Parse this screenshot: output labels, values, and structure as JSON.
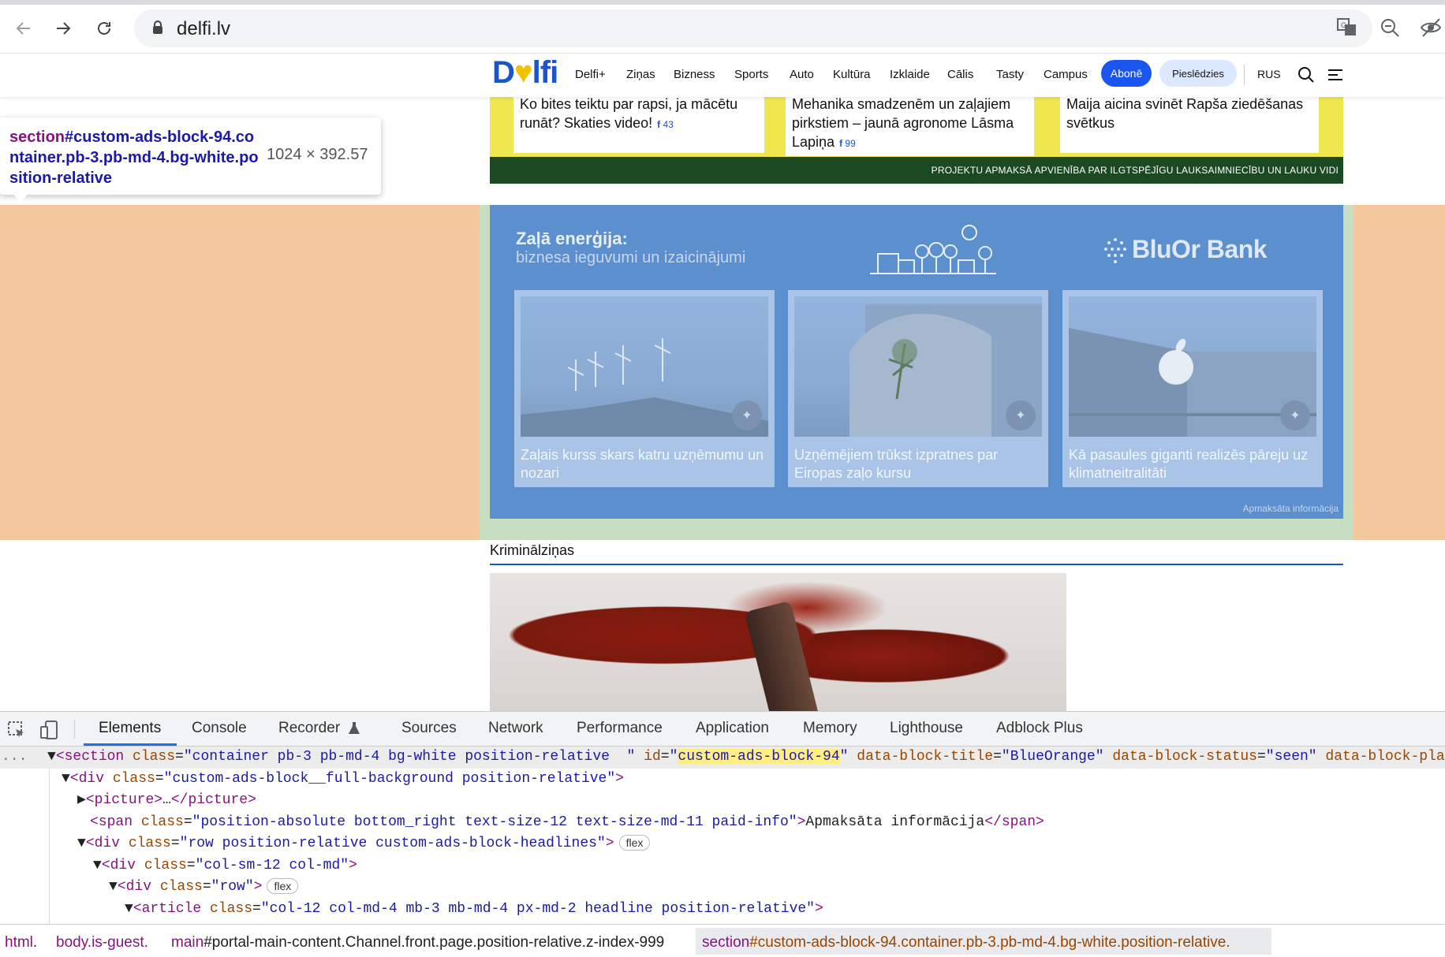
{
  "browser": {
    "url": "delfi.lv"
  },
  "site": {
    "logo": "Delfi",
    "nav": [
      "Delfi+",
      "Ziņas",
      "Bizness",
      "Sports",
      "Auto",
      "Kultūra",
      "Izklaide",
      "Cālis",
      "Tasty",
      "Campus"
    ],
    "subscribe": "Abonē",
    "login": "Pieslēdzies",
    "lang": "RUS"
  },
  "strip": {
    "cards": [
      {
        "title": "Ko bites teiktu par rapsi, ja mācētu runāt? Skaties video!",
        "fb": "43"
      },
      {
        "title": "Mehanika smadzenēm un zaļajiem pirkstiem – jaunā agronome Lāsma Lapiņa",
        "fb": "99"
      },
      {
        "title": "Maija aicina svinēt Rapša ziedēšanas svētkus",
        "fb": ""
      }
    ],
    "footer": "PROJEKTU APMAKSĀ APVIENĪBA PAR ILGTSPĒJĪGU LAUKSAIMNIECĪBU UN LAUKU VIDI"
  },
  "tooltip": {
    "tag": "section",
    "selector": "#custom-ads-block-94.container.pb-3.pb-md-4.bg-white.position-relative",
    "dims": "1024 × 392.57"
  },
  "ad": {
    "title": "Zaļā enerģija:",
    "subtitle": "biznesa ieguvumi un izaicinājumi",
    "brand": "BluOr Bank",
    "cards": [
      {
        "caption": "Zaļais kurss skars katru uzņēmumu un nozari"
      },
      {
        "caption": "Uzņēmējiem trūkst izpratnes par Eiropas zaļo kursu"
      },
      {
        "caption": "Kā pasaules giganti realizēs pāreju uz klimatneitralitāti"
      }
    ],
    "paid": "Apmaksāta informācija"
  },
  "section": {
    "title": "Kriminālziņas"
  },
  "devtools": {
    "tabs": [
      "Elements",
      "Console",
      "Recorder",
      "Sources",
      "Network",
      "Performance",
      "Application",
      "Memory",
      "Lighthouse",
      "Adblock Plus"
    ],
    "active_tab": "Elements",
    "lines": [
      {
        "indent": 66,
        "prefix": "▼",
        "html": "section"
      },
      {
        "indent": 82,
        "prefix": "▼",
        "html": "div-bg"
      },
      {
        "indent": 100,
        "prefix": "▶",
        "html": "picture"
      },
      {
        "indent": 100,
        "prefix": "",
        "html": "span"
      },
      {
        "indent": 100,
        "prefix": "▼",
        "html": "div-row"
      },
      {
        "indent": 120,
        "prefix": "▼",
        "html": "div-col"
      },
      {
        "indent": 140,
        "prefix": "▼",
        "html": "div-row2"
      },
      {
        "indent": 160,
        "prefix": "▼",
        "html": "article"
      }
    ],
    "breadcrumbs": [
      {
        "tag": "html",
        "rest": "."
      },
      {
        "tag": "body",
        "rest": ".is-guest."
      },
      {
        "tag": "main",
        "rest": "#portal-main-content.Channel.front.page.position-relative.z-index-999"
      },
      {
        "tag": "section",
        "rest": "#custom-ads-block-94.container.pb-3.pb-md-4.bg-white.position-relative."
      }
    ]
  }
}
